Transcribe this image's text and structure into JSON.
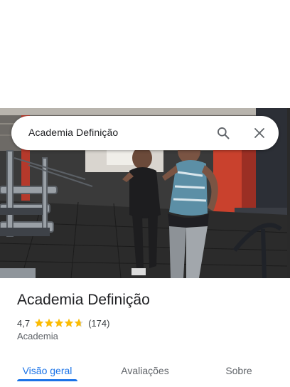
{
  "search": {
    "query": "Academia Definição",
    "search_icon": "search-icon",
    "close_icon": "close-icon"
  },
  "place": {
    "name": "Academia Definição",
    "rating": "4,7",
    "rating_value": 4.7,
    "review_count": "(174)",
    "category": "Academia",
    "star_color": "#fbbc04"
  },
  "tabs": [
    {
      "label": "Visão geral",
      "active": true
    },
    {
      "label": "Avaliações",
      "active": false
    },
    {
      "label": "Sobre",
      "active": false
    }
  ],
  "colors": {
    "accent": "#1a73e8",
    "text_primary": "#202124",
    "text_secondary": "#5f6368"
  }
}
